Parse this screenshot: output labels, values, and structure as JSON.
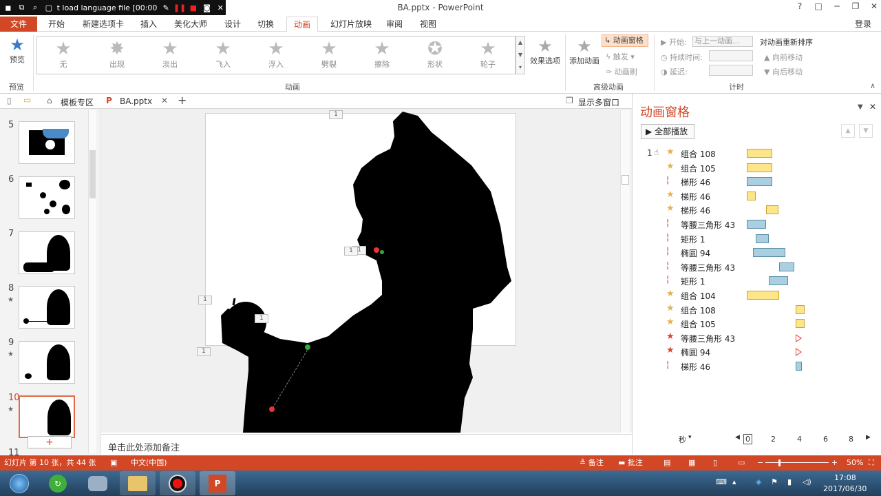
{
  "recording_bar": {
    "title": "t load language file [00:00"
  },
  "window": {
    "title": "BA.pptx - PowerPoint",
    "help": "?",
    "ribbon_opts": "□",
    "minimize": "─",
    "restore": "❐",
    "close": "✕"
  },
  "ribbon_tabs": [
    "文件",
    "开始",
    "新建选项卡",
    "插入",
    "美化大师",
    "设计",
    "切换",
    "动画",
    "幻灯片放映",
    "审阅",
    "视图"
  ],
  "active_tab": "动画",
  "login": "登录",
  "ribbon": {
    "preview": {
      "label": "预览",
      "group": "预览"
    },
    "animations": [
      "无",
      "出现",
      "淡出",
      "飞入",
      "浮入",
      "劈裂",
      "擦除",
      "形状",
      "轮子"
    ],
    "animations_group": "动画",
    "effect_options": "效果选项",
    "add_animation": "添加动画",
    "animation_pane_btn": "动画窗格",
    "trigger": "触发",
    "anim_painter": "动画刷",
    "advanced_group": "高级动画",
    "start_label": "开始:",
    "start_value": "与上一动画...",
    "duration_label": "持续时间:",
    "delay_label": "延迟:",
    "timing_group": "计时",
    "reorder_title": "对动画重新排序",
    "move_earlier": "向前移动",
    "move_later": "向后移动"
  },
  "doc_tabs": {
    "template": "模板专区",
    "file": "BA.pptx",
    "multi": "显示多窗口"
  },
  "slides": [
    {
      "num": "5",
      "star": ""
    },
    {
      "num": "6",
      "star": ""
    },
    {
      "num": "7",
      "star": ""
    },
    {
      "num": "8",
      "star": "★"
    },
    {
      "num": "9",
      "star": "★"
    },
    {
      "num": "10",
      "star": "★"
    },
    {
      "num": "11",
      "star": ""
    }
  ],
  "selected_slide": "10",
  "add_slide": "+",
  "notes_placeholder": "单击此处添加备注",
  "slide_tags": [
    "1",
    "1",
    "1",
    "1",
    "1",
    "1"
  ],
  "pane": {
    "title": "动画窗格",
    "play_all": "全部播放",
    "first_index": "1",
    "items": [
      {
        "icon": "star",
        "color": "#e8b04a",
        "name": "组合 108",
        "bar": "y",
        "start": 0,
        "end": 2
      },
      {
        "icon": "star",
        "color": "#e8b04a",
        "name": "组合 105",
        "bar": "y",
        "start": 0,
        "end": 2
      },
      {
        "icon": "path",
        "color": "#c0392b",
        "name": "梯形 46",
        "bar": "b",
        "start": 0,
        "end": 2
      },
      {
        "icon": "star",
        "color": "#e8b04a",
        "name": "梯形 46",
        "bar": "y",
        "start": 0,
        "end": 0.7
      },
      {
        "icon": "star",
        "color": "#e8b04a",
        "name": "梯形 46",
        "bar": "y",
        "start": 1.5,
        "end": 2.5
      },
      {
        "icon": "path",
        "color": "#c0392b",
        "name": "等腰三角形 43",
        "bar": "b",
        "start": 0,
        "end": 1.5
      },
      {
        "icon": "path",
        "color": "#c0392b",
        "name": "矩形 1",
        "bar": "b",
        "start": 0.7,
        "end": 1.7
      },
      {
        "icon": "path",
        "color": "#c0392b",
        "name": "椭圆 94",
        "bar": "b",
        "start": 0.5,
        "end": 3
      },
      {
        "icon": "path",
        "color": "#c0392b",
        "name": "等腰三角形 43",
        "bar": "b",
        "start": 2.5,
        "end": 3.7
      },
      {
        "icon": "path",
        "color": "#c0392b",
        "name": "矩形 1",
        "bar": "b",
        "start": 1.7,
        "end": 3.2
      },
      {
        "icon": "star",
        "color": "#e8b04a",
        "name": "组合 104",
        "bar": "y",
        "start": 0,
        "end": 2.5
      },
      {
        "icon": "star",
        "color": "#e8b04a",
        "name": "组合 108",
        "bar": "y",
        "start": 3.8,
        "end": 4.5
      },
      {
        "icon": "star",
        "color": "#e8b04a",
        "name": "组合 105",
        "bar": "y",
        "start": 3.8,
        "end": 4.5
      },
      {
        "icon": "star",
        "color": "#d9432f",
        "name": "等腰三角形 43",
        "bar": "t",
        "start": 3.8,
        "end": 4.3
      },
      {
        "icon": "star",
        "color": "#d9432f",
        "name": "椭圆 94",
        "bar": "t",
        "start": 3.8,
        "end": 4.3
      },
      {
        "icon": "path",
        "color": "#c0392b",
        "name": "梯形 46",
        "bar": "b",
        "start": 3.8,
        "end": 4.3
      }
    ],
    "timeline_unit": "秒",
    "timeline_ticks": [
      "0",
      "2",
      "4",
      "6",
      "8"
    ]
  },
  "status": {
    "slide_info": "幻灯片 第 10 张，共 44 张",
    "language": "中文(中国)",
    "notes": "备注",
    "comments": "批注",
    "zoom": "50%"
  },
  "taskbar": {
    "time": "17:08",
    "date": "2017/06/30"
  },
  "colors": {
    "accent": "#d24726",
    "status_bar": "#d24726"
  }
}
